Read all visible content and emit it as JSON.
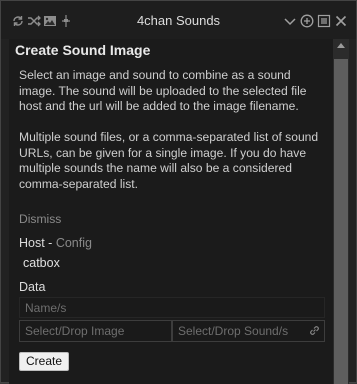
{
  "titlebar": {
    "title": "4chan Sounds",
    "left_icons": [
      "repeat-icon",
      "shuffle-icon",
      "image-icon",
      "volume-icon"
    ],
    "right_icons": [
      "chevron-down-icon",
      "add-icon",
      "playlist-icon",
      "close-icon"
    ]
  },
  "panel": {
    "heading": "Create Sound Image",
    "description_1": "Select an image and sound to combine as a sound image. The sound will be uploaded to the selected file host and the url will be added to the image filename.",
    "description_2": "Multiple sound files, or a comma-separated list of sound URLs, can be given for a single image. If you do have multiple sounds the name will also be a considered comma-separated list.",
    "dismiss": "Dismiss",
    "host_label": "Host",
    "host_separator": " - ",
    "config_link": "Config",
    "host_value": "catbox",
    "data_label": "Data",
    "names_placeholder": "Name/s",
    "image_placeholder": "Select/Drop Image",
    "sound_placeholder": "Select/Drop Sound/s",
    "create_button": "Create"
  }
}
